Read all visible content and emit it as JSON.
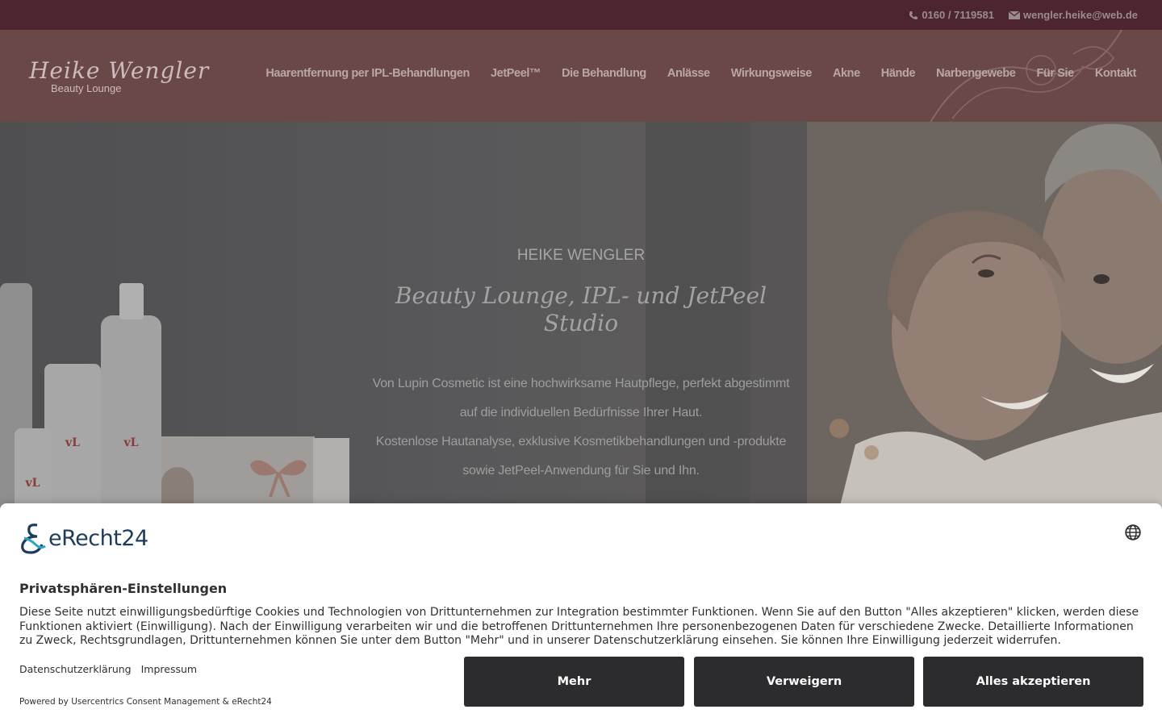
{
  "topbar": {
    "phone": "0160 / 7119581",
    "email": "wengler.heike@web.de"
  },
  "header": {
    "logo_script": "Heike Wengler",
    "logo_sub": "Beauty Lounge",
    "nav": [
      "Haarentfernung per IPL-Behandlungen",
      "JetPeel™",
      "Die Behandlung",
      "Anlässe",
      "Wirkungsweise",
      "Akne",
      "Hände",
      "Narbengewebe",
      "Für Sie",
      "Kontakt"
    ]
  },
  "hero": {
    "eyebrow": "HEIKE WENGLER",
    "title_line1": "Beauty Lounge, IPL- und JetPeel",
    "title_line2": "Studio",
    "desc_line1": "Von Lupin Cosmetic ist eine hochwirksame Hautpflege, perfekt abgestimmt",
    "desc_line2": "auf die individuellen Bedürfnisse Ihrer Haut.",
    "desc_line3": "Kostenlose Hautanalyse, exklusive Kosmetikbehandlungen und -produkte",
    "desc_line4": "sowie JetPeel-Anwendung für Sie und Ihn."
  },
  "consent": {
    "brand": "eRecht24",
    "heading": "Privatsphären-Einstellungen",
    "body": "Diese Seite nutzt einwilligungsbedürftige Cookies und Technologien von Drittunternehmen zur Integration bestimmter Funktionen. Wenn Sie auf den Button \"Alles akzeptieren\" klicken, werden diese Funktionen aktiviert (Einwilligung). Nach der Einwilligung verarbeiten wir und die betroffenen Drittunternehmen Ihre personenbezogenen Daten für verschiedene Zwecke. Detaillierte Informationen zu Zweck, Rechtsgrundlagen, Drittunternehmen können Sie unter dem Button \"Mehr\" und in unserer Datenschutzerklärung einsehen. Sie können Ihre Einwilligung jederzeit widerrufen.",
    "link_privacy": "Datenschutzerklärung",
    "link_imprint": "Impressum",
    "powered": "Powered by Usercentrics Consent Management & eRecht24",
    "btn_more": "Mehr",
    "btn_deny": "Verweigern",
    "btn_accept": "Alles akzeptieren"
  },
  "icons": {
    "phone": "phone-icon",
    "email": "envelope-icon",
    "language": "globe-icon"
  },
  "colors": {
    "topbar": "#4d2530",
    "header": "#6a4848",
    "button": "#2c2c2e",
    "brand": "#1d3b5b"
  }
}
